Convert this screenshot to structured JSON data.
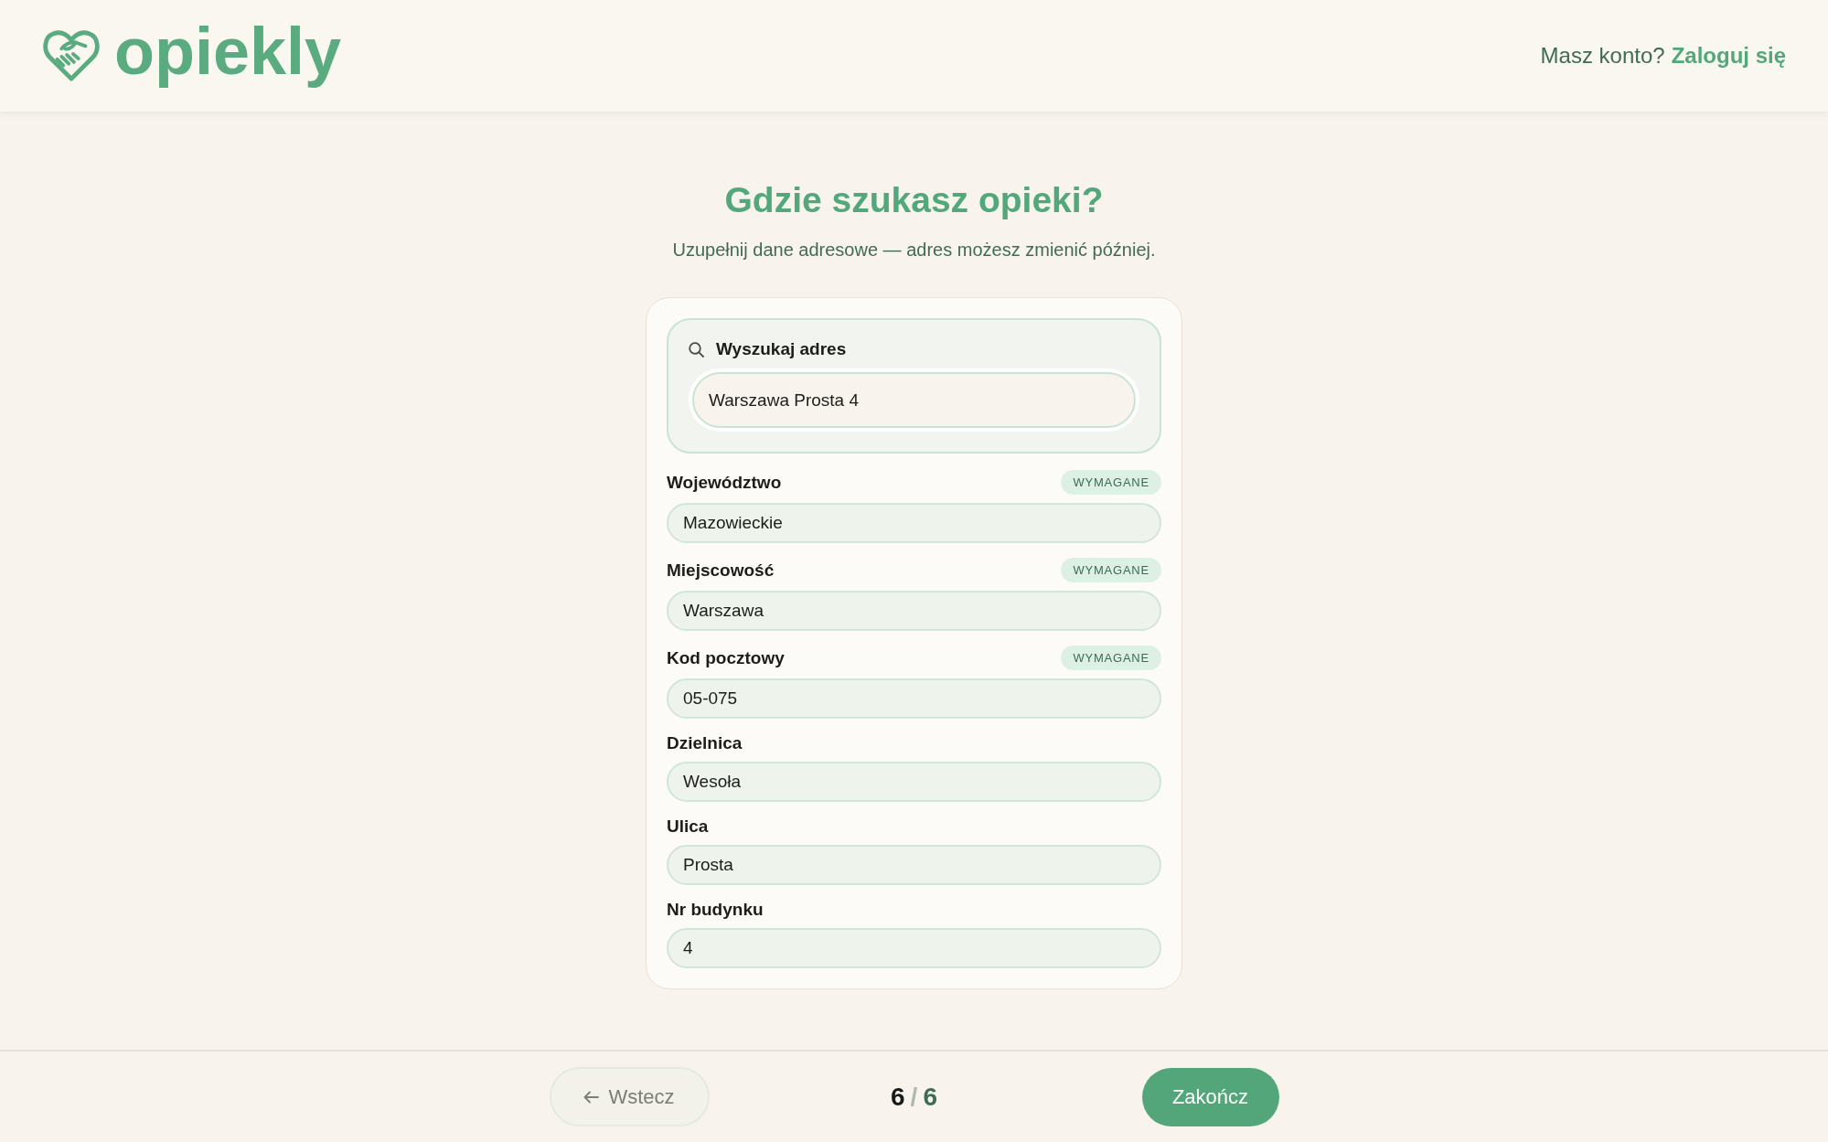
{
  "header": {
    "logo": "opiekly",
    "account_prompt": "Masz konto?",
    "login_link": "Zaloguj się"
  },
  "title": "Gdzie szukasz opieki?",
  "subtitle": "Uzupełnij dane adresowe — adres możesz zmienić później.",
  "search": {
    "label": "Wyszukaj adres",
    "value": "Warszawa Prosta 4",
    "focused": true
  },
  "fields": [
    {
      "label": "Województwo",
      "badge": "WYMAGANE",
      "value": "Mazowieckie"
    },
    {
      "label": "Miejscowość",
      "badge": "WYMAGANE",
      "value": "Warszawa"
    },
    {
      "label": "Kod pocztowy",
      "badge": "WYMAGANE",
      "value": "05-075"
    },
    {
      "label": "Dzielnica",
      "value": "Wesoła"
    },
    {
      "label": "Ulica",
      "value": "Prosta"
    },
    {
      "label": "Nr budynku",
      "value": "4"
    }
  ],
  "footer": {
    "back_button": {
      "label": "Wstecz"
    },
    "step": {
      "current": "6",
      "separator": "/",
      "total": "6"
    },
    "finish_button": {
      "label": "Zakończ"
    }
  }
}
